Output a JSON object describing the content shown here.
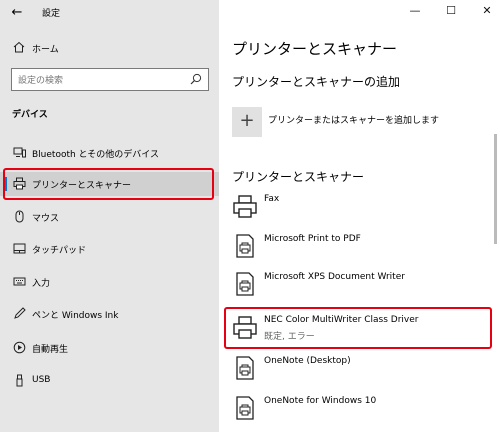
{
  "window": {
    "title": "設定",
    "min_icon": "minimize-icon",
    "max_icon": "maximize-icon",
    "close_icon": "close-icon"
  },
  "sidebar": {
    "home_label": "ホーム",
    "search_placeholder": "設定の検索",
    "section_title": "デバイス",
    "items": [
      {
        "label": "Bluetooth とその他のデバイス",
        "icon": "bluetooth-devices-icon"
      },
      {
        "label": "プリンターとスキャナー",
        "icon": "printer-icon",
        "selected": true
      },
      {
        "label": "マウス",
        "icon": "mouse-icon"
      },
      {
        "label": "タッチパッド",
        "icon": "touchpad-icon"
      },
      {
        "label": "入力",
        "icon": "keyboard-icon"
      },
      {
        "label": "ペンと Windows Ink",
        "icon": "pen-icon"
      },
      {
        "label": "自動再生",
        "icon": "autoplay-icon"
      },
      {
        "label": "USB",
        "icon": "usb-icon"
      }
    ]
  },
  "main": {
    "page_title": "プリンターとスキャナー",
    "add_section_title": "プリンターとスキャナーの追加",
    "add_label": "プリンターまたはスキャナーを追加します",
    "list_title": "プリンターとスキャナー",
    "printers": [
      {
        "name": "Fax",
        "status": ""
      },
      {
        "name": "Microsoft Print to PDF",
        "status": ""
      },
      {
        "name": "Microsoft XPS Document Writer",
        "status": ""
      },
      {
        "name": "NEC Color MultiWriter Class Driver",
        "status": "既定, エラー"
      },
      {
        "name": "OneNote (Desktop)",
        "status": ""
      },
      {
        "name": "OneNote for Windows 10",
        "status": ""
      }
    ]
  },
  "colors": {
    "highlight": "#e60012",
    "accent": "#0078d4",
    "sidebar_bg": "#e6e6e6"
  }
}
